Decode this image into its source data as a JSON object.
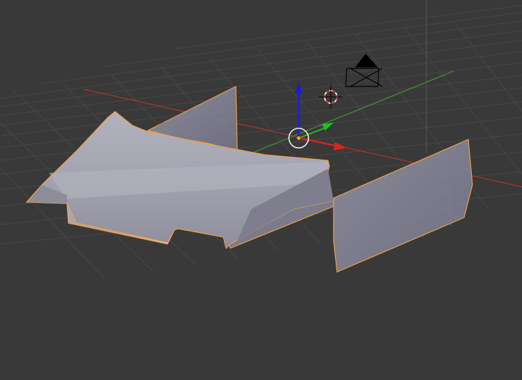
{
  "viewport": {
    "view": "3D Viewport",
    "colors": {
      "background": "#393939",
      "grid": "#4a4a4a",
      "x_axis": "#b83030",
      "y_axis": "#3f9a2e",
      "mesh_fill": "#9c9caa",
      "selection_outline": "#f0a040",
      "gizmo_x": "#e02020",
      "gizmo_y": "#20c020",
      "gizmo_z": "#2020e0"
    },
    "objects": [
      {
        "name": "hood-panel",
        "icon": "mesh-object",
        "selected": true
      },
      {
        "name": "side-panel-left",
        "icon": "mesh-object",
        "selected": true
      },
      {
        "name": "side-panel-right",
        "icon": "mesh-object",
        "selected": true
      },
      {
        "name": "camera",
        "icon": "camera-icon",
        "selected": false
      },
      {
        "name": "3d-cursor",
        "icon": "crosshair-icon",
        "selected": false
      }
    ],
    "gizmo": {
      "mode": "translate",
      "axes": [
        "x",
        "y",
        "z"
      ]
    }
  }
}
